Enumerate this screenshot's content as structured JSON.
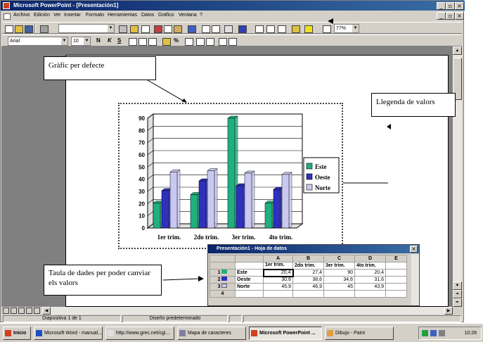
{
  "window": {
    "title": "Microsoft PowerPoint - [Presentación1]"
  },
  "menu": [
    "Archivo",
    "Edición",
    "Ver",
    "Insertar",
    "Formato",
    "Herramientas",
    "Datos",
    "Gráfico",
    "Ventana",
    "?"
  ],
  "toolbar": {
    "zoom": "77%",
    "font": "Arial",
    "size": "10",
    "bold": "N",
    "italic": "K",
    "underline": "S",
    "percent": "%"
  },
  "callouts": {
    "default_chart": "Gràfic per defecte",
    "legend_values": "Llegenda de valors",
    "data_table": "Taula de dades per poder canviar els valors"
  },
  "chart_data": {
    "type": "bar",
    "categories": [
      "1er trim.",
      "2do trim.",
      "3er trim.",
      "4to trim."
    ],
    "series": [
      {
        "name": "Este",
        "values": [
          20.4,
          27.4,
          90,
          20.4
        ],
        "color": "#20b080"
      },
      {
        "name": "Oeste",
        "values": [
          30.6,
          38.6,
          34.6,
          31.6
        ],
        "color": "#3030c0"
      },
      {
        "name": "Norte",
        "values": [
          45.9,
          46.9,
          45,
          43.9
        ],
        "color": "#c8c8f0"
      }
    ],
    "yticks": [
      "0",
      "10",
      "20",
      "30",
      "40",
      "50",
      "60",
      "70",
      "80",
      "90"
    ],
    "ylim": [
      0,
      90
    ],
    "legend": "right",
    "grid": true
  },
  "datasheet": {
    "title": "Presentación1 - Hoja de datos",
    "col_letters": [
      "A",
      "B",
      "C",
      "D",
      "E"
    ],
    "col_headers": [
      "1er trim.",
      "2do trim.",
      "3er trim.",
      "4to trim."
    ],
    "rows": [
      {
        "num": "1",
        "label": "Este",
        "values": [
          "20,4",
          "27,4",
          "90",
          "20,4"
        ]
      },
      {
        "num": "2",
        "label": "Oeste",
        "values": [
          "30,6",
          "38,6",
          "34,6",
          "31,6"
        ]
      },
      {
        "num": "3",
        "label": "Norte",
        "values": [
          "45,9",
          "46,9",
          "45",
          "43,9"
        ]
      },
      {
        "num": "4",
        "label": "",
        "values": [
          "",
          "",
          "",
          ""
        ]
      }
    ]
  },
  "status": {
    "slide": "Diapositiva 1 de 1",
    "design": "Diseño predeterminado"
  },
  "taskbar": {
    "start": "Inicio",
    "tasks": [
      "Microsoft Word - manual...",
      "http://www.grec.net/cgi...",
      "Mapa de caracteres",
      "Microsoft PowerPoint ...",
      "Dibujo - Paint"
    ],
    "clock": "10:28"
  }
}
